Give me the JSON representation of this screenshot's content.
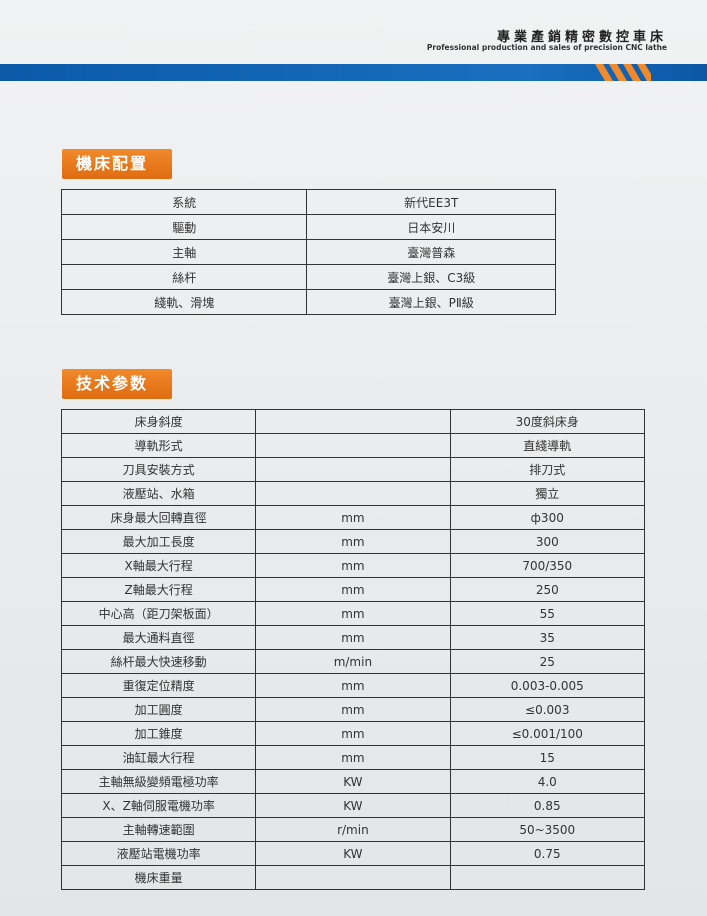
{
  "header": {
    "brand_cn": "專業產銷精密數控車床",
    "brand_en": "Professional production and sales of precision CNC lathe",
    "accent_blue": "#0a5aa8",
    "accent_orange": "#f08a2a"
  },
  "config": {
    "title": "機床配置",
    "rows": [
      {
        "name": "系統",
        "value": "新代EE3T"
      },
      {
        "name": "驅動",
        "value": "日本安川"
      },
      {
        "name": "主軸",
        "value": "臺灣普森"
      },
      {
        "name": "絲杆",
        "value": "臺灣上銀、C3級"
      },
      {
        "name": "綫軌、滑塊",
        "value": "臺灣上銀、PⅡ級"
      }
    ]
  },
  "specs": {
    "title": "技术参数",
    "rows": [
      {
        "name": "床身斜度",
        "unit": "",
        "value": "30度斜床身"
      },
      {
        "name": "導軌形式",
        "unit": "",
        "value": "直綫導軌"
      },
      {
        "name": "刀具安裝方式",
        "unit": "",
        "value": "排刀式"
      },
      {
        "name": "液壓站、水箱",
        "unit": "",
        "value": "獨立"
      },
      {
        "name": "床身最大回轉直徑",
        "unit": "mm",
        "value": "ф300"
      },
      {
        "name": "最大加工長度",
        "unit": "mm",
        "value": "300"
      },
      {
        "name": "X軸最大行程",
        "unit": "mm",
        "value": "700/350"
      },
      {
        "name": "Z軸最大行程",
        "unit": "mm",
        "value": "250"
      },
      {
        "name": "中心高（距刀架板面）",
        "unit": "mm",
        "value": "55"
      },
      {
        "name": "最大通料直徑",
        "unit": "mm",
        "value": "35"
      },
      {
        "name": "絲杆最大快速移動",
        "unit": "m/min",
        "value": "25"
      },
      {
        "name": "重復定位精度",
        "unit": "mm",
        "value": "0.003-0.005"
      },
      {
        "name": "加工圓度",
        "unit": "mm",
        "value": "≤0.003"
      },
      {
        "name": "加工錐度",
        "unit": "mm",
        "value": "≤0.001/100"
      },
      {
        "name": "油缸最大行程",
        "unit": "mm",
        "value": "15"
      },
      {
        "name": "主軸無級變頻電極功率",
        "unit": "KW",
        "value": "4.0"
      },
      {
        "name": "X、Z軸伺服電機功率",
        "unit": "KW",
        "value": "0.85"
      },
      {
        "name": "主軸轉速範圍",
        "unit": "r/min",
        "value": "50~3500"
      },
      {
        "name": "液壓站電機功率",
        "unit": "KW",
        "value": "0.75"
      },
      {
        "name": "機床重量",
        "unit": "",
        "value": ""
      }
    ]
  }
}
